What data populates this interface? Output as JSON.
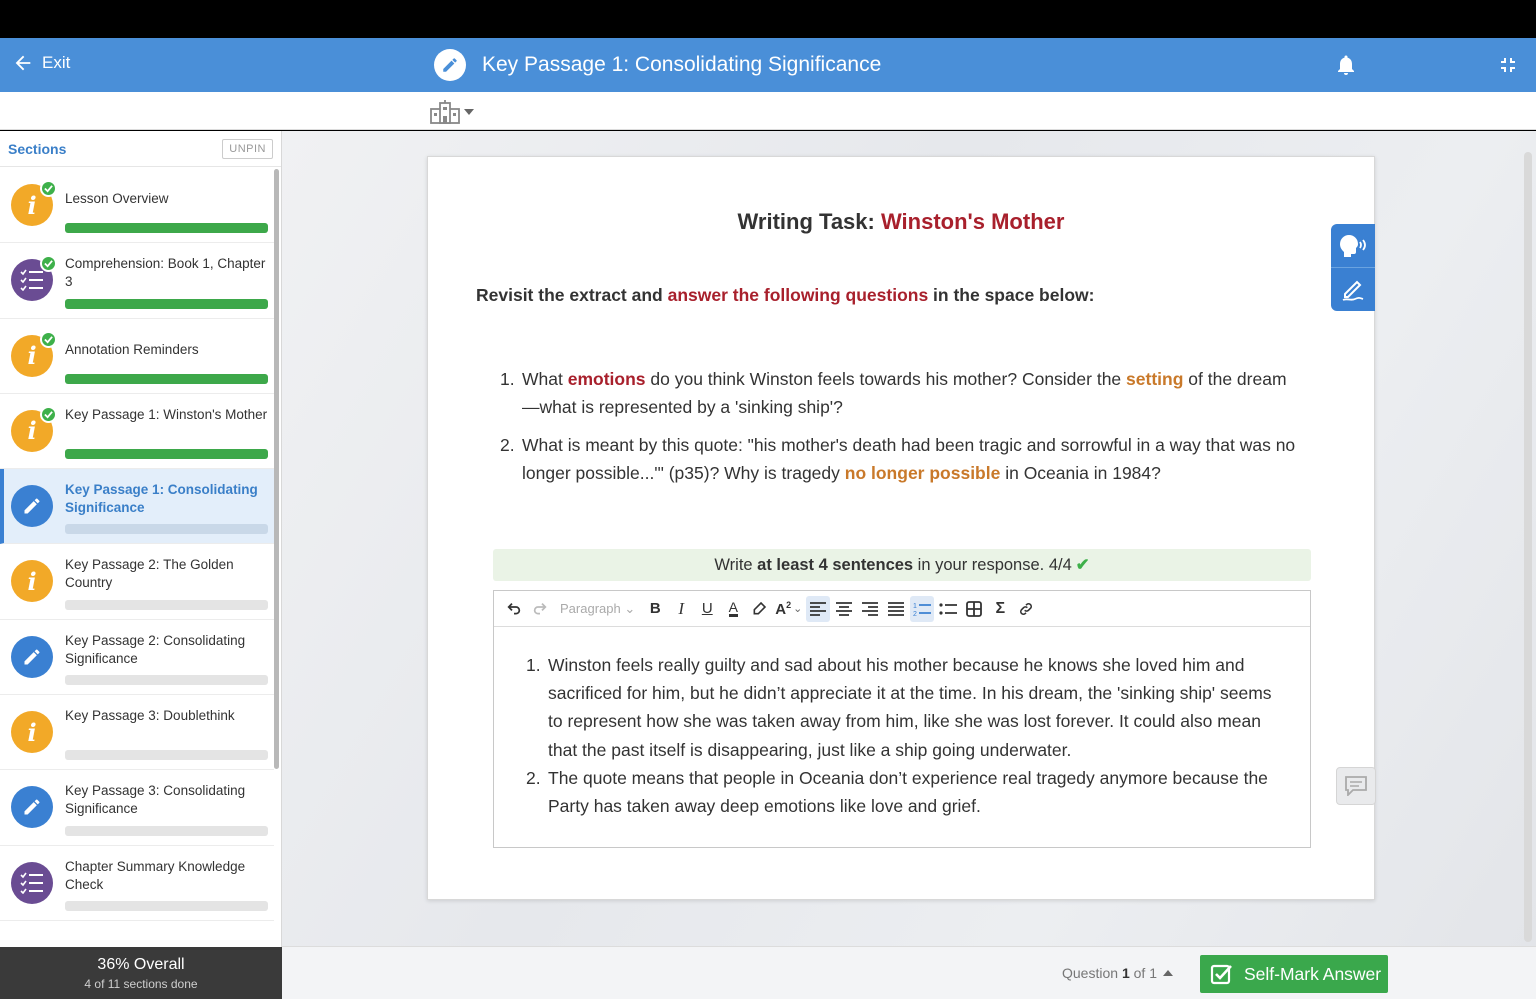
{
  "topbar": {
    "exit_label": "Exit",
    "title": "Key Passage 1: Consolidating Significance"
  },
  "sidebar": {
    "title": "Sections",
    "unpin_label": "UNPIN",
    "items": [
      {
        "label": "Lesson Overview",
        "icon": "info-icon",
        "color": "#f2a928",
        "completed": true,
        "progress": 1
      },
      {
        "label": "Comprehension: Book 1, Chapter 3",
        "icon": "checklist-icon",
        "color": "#6a4c93",
        "completed": true,
        "progress": 1
      },
      {
        "label": "Annotation Reminders",
        "icon": "info-icon",
        "color": "#f2a928",
        "completed": true,
        "progress": 1
      },
      {
        "label": "Key Passage 1: Winston's Mother",
        "icon": "info-icon",
        "color": "#f2a928",
        "completed": true,
        "progress": 1
      },
      {
        "label": "Key Passage 1: Consolidating Significance",
        "icon": "pencil-icon",
        "color": "#3a80d2",
        "completed": false,
        "progress": 0,
        "active": true
      },
      {
        "label": "Key Passage 2: The Golden Country",
        "icon": "info-icon",
        "color": "#f2a928",
        "completed": false,
        "progress": 0
      },
      {
        "label": "Key Passage 2: Consolidating Significance",
        "icon": "pencil-icon",
        "color": "#3a80d2",
        "completed": false,
        "progress": 0
      },
      {
        "label": "Key Passage 3: Doublethink",
        "icon": "info-icon",
        "color": "#f2a928",
        "completed": false,
        "progress": 0
      },
      {
        "label": "Key Passage 3: Consolidating Significance",
        "icon": "pencil-icon",
        "color": "#3a80d2",
        "completed": false,
        "progress": 0
      },
      {
        "label": "Chapter Summary Knowledge Check",
        "icon": "checklist-icon",
        "color": "#6a4c93",
        "completed": false,
        "progress": 0
      }
    ],
    "overall": {
      "percent_label": "36% Overall",
      "sub_label": "4 of 11 sections done",
      "percent": 36
    }
  },
  "task": {
    "title_prefix": "Writing Task: ",
    "title_highlight": "Winston's Mother",
    "instruction": {
      "pre": "Revisit the extract and ",
      "highlight": "answer the following questions",
      "post": " in the space below:"
    },
    "questions": [
      {
        "num": "1.",
        "parts": [
          "What ",
          "emotions",
          " do you think Winston feels towards his mother? Consider the ",
          "setting",
          " of the dream—what is represented by a 'sinking ship'?"
        ]
      },
      {
        "num": "2.",
        "parts": [
          "What is meant by this quote: \"his mother's death had been tragic and sorrowful in a way that was no longer possible...'\" (p35)? Why is tragedy ",
          "no longer possible",
          " in Oceania in 1984?"
        ]
      }
    ],
    "requirement": {
      "pre": "Write ",
      "bold": "at least 4 sentences",
      "post": " in your response. 4/4"
    }
  },
  "editor": {
    "paragraph_label": "Paragraph",
    "answers": [
      "Winston feels really guilty and sad about his mother because he knows she loved him and sacrificed for him, but he didn’t appreciate it at the time. In his dream, the 'sinking ship' seems to represent how she was taken away from him, like she was lost forever. It could also mean that the past itself is disappearing, just like a ship going underwater.",
      "The quote means that people in Oceania don’t experience real tragedy anymore because the Party has taken away deep emotions like love and grief."
    ]
  },
  "footer": {
    "question_prefix": "Question ",
    "question_current": "1",
    "question_suffix": " of 1",
    "selfmark_label": "Self-Mark Answer"
  },
  "colors": {
    "topbar": "#4a8fd8",
    "accent_red": "#a8202c",
    "accent_orange": "#c9792a",
    "success_green": "#3aa84c"
  }
}
